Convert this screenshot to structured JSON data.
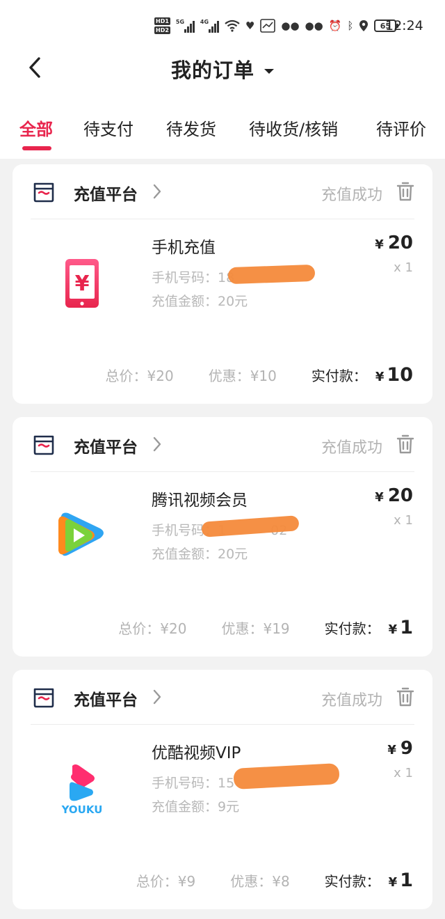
{
  "status_bar": {
    "time": "12:24",
    "battery": "65",
    "net1": "5G",
    "net2": "4G"
  },
  "header": {
    "title": "我的订单"
  },
  "tabs": [
    {
      "label": "全部",
      "active": true
    },
    {
      "label": "待支付"
    },
    {
      "label": "待发货"
    },
    {
      "label": "待收货/核销"
    },
    {
      "label": "待评价"
    }
  ],
  "orders": [
    {
      "store": "充值平台",
      "status": "充值成功",
      "product": "手机充值",
      "phone_label": "手机号码：",
      "phone_value": "18",
      "amount_line": "充值金额：20元",
      "price": "20",
      "qty": "x 1",
      "total": "总价：¥20",
      "discount": "优惠：¥10",
      "paid_label": "实付款：",
      "paid": "10",
      "icon": "phone-recharge-icon"
    },
    {
      "store": "充值平台",
      "status": "充值成功",
      "product": "腾讯视频会员",
      "phone_label": "手机号码：",
      "phone_value": "1",
      "phone_suffix": "02",
      "amount_line": "充值金额：20元",
      "price": "20",
      "qty": "x 1",
      "total": "总价：¥20",
      "discount": "优惠：¥19",
      "paid_label": "实付款：",
      "paid": "1",
      "icon": "tencent-video-icon"
    },
    {
      "store": "充值平台",
      "status": "充值成功",
      "product": "优酷视频VIP",
      "phone_label": "手机号码：",
      "phone_value": "15",
      "amount_line": "充值金额：9元",
      "price": "9",
      "qty": "x 1",
      "total": "总价：¥9",
      "discount": "优惠：¥8",
      "paid_label": "实付款：",
      "paid": "1",
      "icon": "youku-icon",
      "logo_text": "YOUKU"
    }
  ],
  "currency": "¥",
  "colors": {
    "accent": "#e8254d",
    "muted": "#b3b3b3",
    "background": "#f2f2f2"
  }
}
